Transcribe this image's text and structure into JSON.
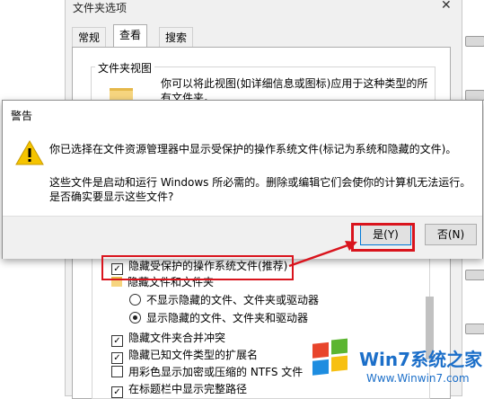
{
  "background_window": {
    "title": "文件夹选项",
    "close_glyph": "✕",
    "tabs": [
      "常规",
      "查看",
      "搜索"
    ],
    "active_tab": "查看",
    "group_label": "文件夹视图",
    "group_desc_line1": "你可以将此视图(如详细信息或图标)应用于这种类型的所",
    "group_desc_line2": "有文件夹。",
    "advanced": {
      "hide_protected": "隐藏受保护的操作系统文件(推荐)",
      "hidden_files_folder": "隐藏文件和文件夹",
      "radio_not_show": "不显示隐藏的文件、文件夹或驱动器",
      "radio_show": "显示隐藏的文件、文件夹和驱动器",
      "hide_merge_conflicts": "隐藏文件夹合并冲突",
      "hide_extensions": "隐藏已知文件类型的扩展名",
      "color_ntfs": "用彩色显示加密或压缩的 NTFS 文件",
      "title_bar_path": "在标题栏中显示完整路径"
    }
  },
  "dialog": {
    "title": "警告",
    "line1": "你已选择在文件资源管理器中显示受保护的操作系统文件(标记为系统和隐藏的文件)。",
    "line2": "这些文件是启动和运行 Windows 所必需的。删除或编辑它们会使你的计算机无法运行。",
    "line3": "是否确实要显示这些文件?",
    "yes_label": "是(Y)",
    "no_label": "否(N)",
    "icon": "warning-icon"
  },
  "watermark": {
    "brand": "Win7系统之家",
    "url": "Www.Winwin7.com"
  },
  "colors": {
    "annotation_red": "#d9141d",
    "dialog_footer": "#f0f0f0",
    "warning_yellow": "#f5c400"
  }
}
